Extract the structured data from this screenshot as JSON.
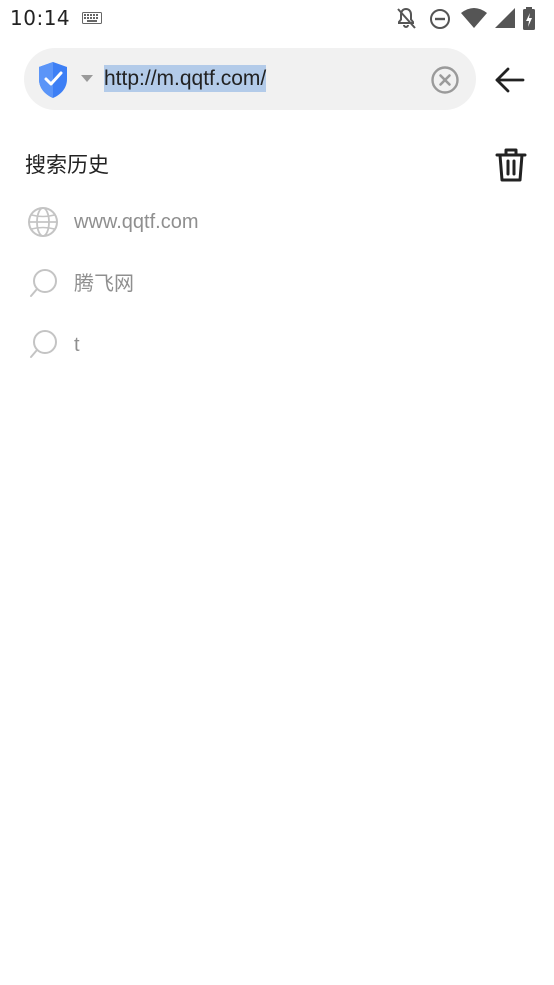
{
  "status_bar": {
    "time": "10:14",
    "icons": [
      "keyboard-icon",
      "notifications-off-icon",
      "do-not-disturb-icon",
      "wifi-icon",
      "cell-signal-icon",
      "battery-icon"
    ]
  },
  "address_bar": {
    "url": "http://m.qqtf.com/",
    "url_selected": true,
    "security_icon": "shield-check-icon",
    "accent_color": "#3d7ff5"
  },
  "history": {
    "title": "搜索历史",
    "items": [
      {
        "label": "www.qqtf.com",
        "icon": "globe-icon"
      },
      {
        "label": "腾飞网",
        "icon": "search-icon"
      },
      {
        "label": "t",
        "icon": "search-icon"
      }
    ]
  },
  "colors": {
    "background": "#ffffff",
    "pill": "#f1f1f1",
    "selection": "#b3cbe9",
    "muted_text": "#8f8f8f"
  }
}
